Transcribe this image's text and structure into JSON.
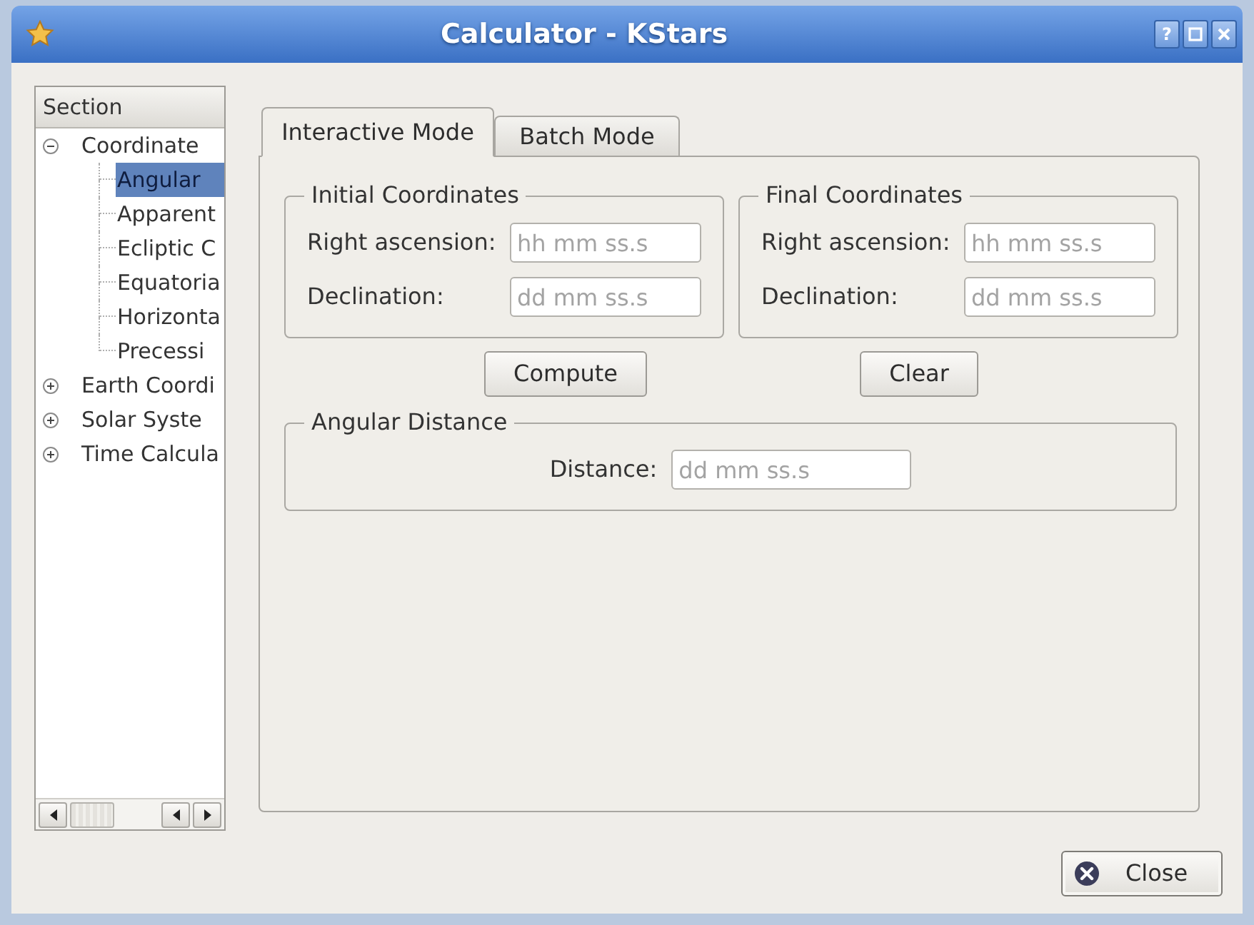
{
  "window": {
    "title": "Calculator - KStars",
    "controls": [
      {
        "kind": "help",
        "glyph": "?"
      },
      {
        "kind": "maximize"
      },
      {
        "kind": "close"
      }
    ]
  },
  "sidebar": {
    "header": "Section",
    "items": [
      {
        "label": "Coordinate",
        "expanded": true,
        "selected": false,
        "children": [
          {
            "label": "Angular",
            "selected": true
          },
          {
            "label": "Apparent",
            "selected": false
          },
          {
            "label": "Ecliptic C",
            "selected": false
          },
          {
            "label": "Equatoria",
            "selected": false
          },
          {
            "label": "Horizonta",
            "selected": false
          },
          {
            "label": "Precessi",
            "selected": false
          }
        ]
      },
      {
        "label": "Earth Coordi",
        "expanded": false,
        "selected": false
      },
      {
        "label": "Solar Syste",
        "expanded": false,
        "selected": false
      },
      {
        "label": "Time Calcula",
        "expanded": false,
        "selected": false
      }
    ]
  },
  "tabs": [
    {
      "label": "Interactive Mode",
      "selected": true
    },
    {
      "label": "Batch Mode",
      "selected": false
    }
  ],
  "groups": [
    {
      "title": "Initial Coordinates",
      "fields": [
        {
          "label": "Right ascension:",
          "placeholder": "hh mm ss.s"
        },
        {
          "label": "Declination:",
          "placeholder": "dd mm ss.s"
        }
      ]
    },
    {
      "title": "Final Coordinates",
      "fields": [
        {
          "label": "Right ascension:",
          "placeholder": "hh mm ss.s"
        },
        {
          "label": "Declination:",
          "placeholder": "dd mm ss.s"
        }
      ]
    }
  ],
  "buttons": [
    "Compute",
    "Clear"
  ],
  "result": {
    "title": "Angular Distance",
    "fields": [
      {
        "label": "Distance:",
        "placeholder": "dd mm ss.s"
      }
    ]
  },
  "footer": {
    "close_button": "Close"
  }
}
